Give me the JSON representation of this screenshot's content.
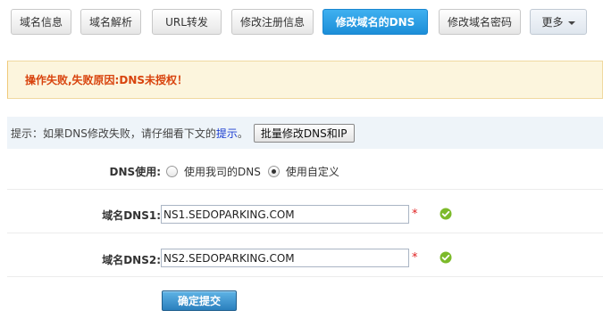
{
  "tabs": [
    {
      "label": "域名信息"
    },
    {
      "label": "域名解析"
    },
    {
      "label": "URL转发"
    },
    {
      "label": "修改注册信息"
    },
    {
      "label": "修改域名的DNS"
    },
    {
      "label": "修改域名密码"
    },
    {
      "label": "更多"
    }
  ],
  "alert": {
    "text": "操作失败,失败原因:DNS未授权！"
  },
  "hint": {
    "prefix": "提示：如果DNS修改失败，请仔细看下文的",
    "link": "提示",
    "suffix": "。",
    "button": "批量修改DNS和IP"
  },
  "form": {
    "dns_usage_label": "DNS使用:",
    "radio_company": "使用我司的DNS",
    "radio_custom": "使用自定义",
    "selected": "使用自定义",
    "dns1_label": "域名DNS1:",
    "dns1_value": "NS1.SEDOPARKING.COM",
    "dns2_label": "域名DNS2:",
    "dns2_value": "NS2.SEDOPARKING.COM",
    "required_mark": "*",
    "submit": "确定提交"
  },
  "colors": {
    "active_tab": "#2a9be3",
    "alert_bg": "#fcf5dd",
    "alert_text": "#d8430d",
    "hint_bg": "#eef4f9",
    "link": "#1a3cd0",
    "ok_icon": "#7cba2a"
  },
  "icons": {
    "ok": "check-circle-icon",
    "more": "caret-down-icon"
  }
}
